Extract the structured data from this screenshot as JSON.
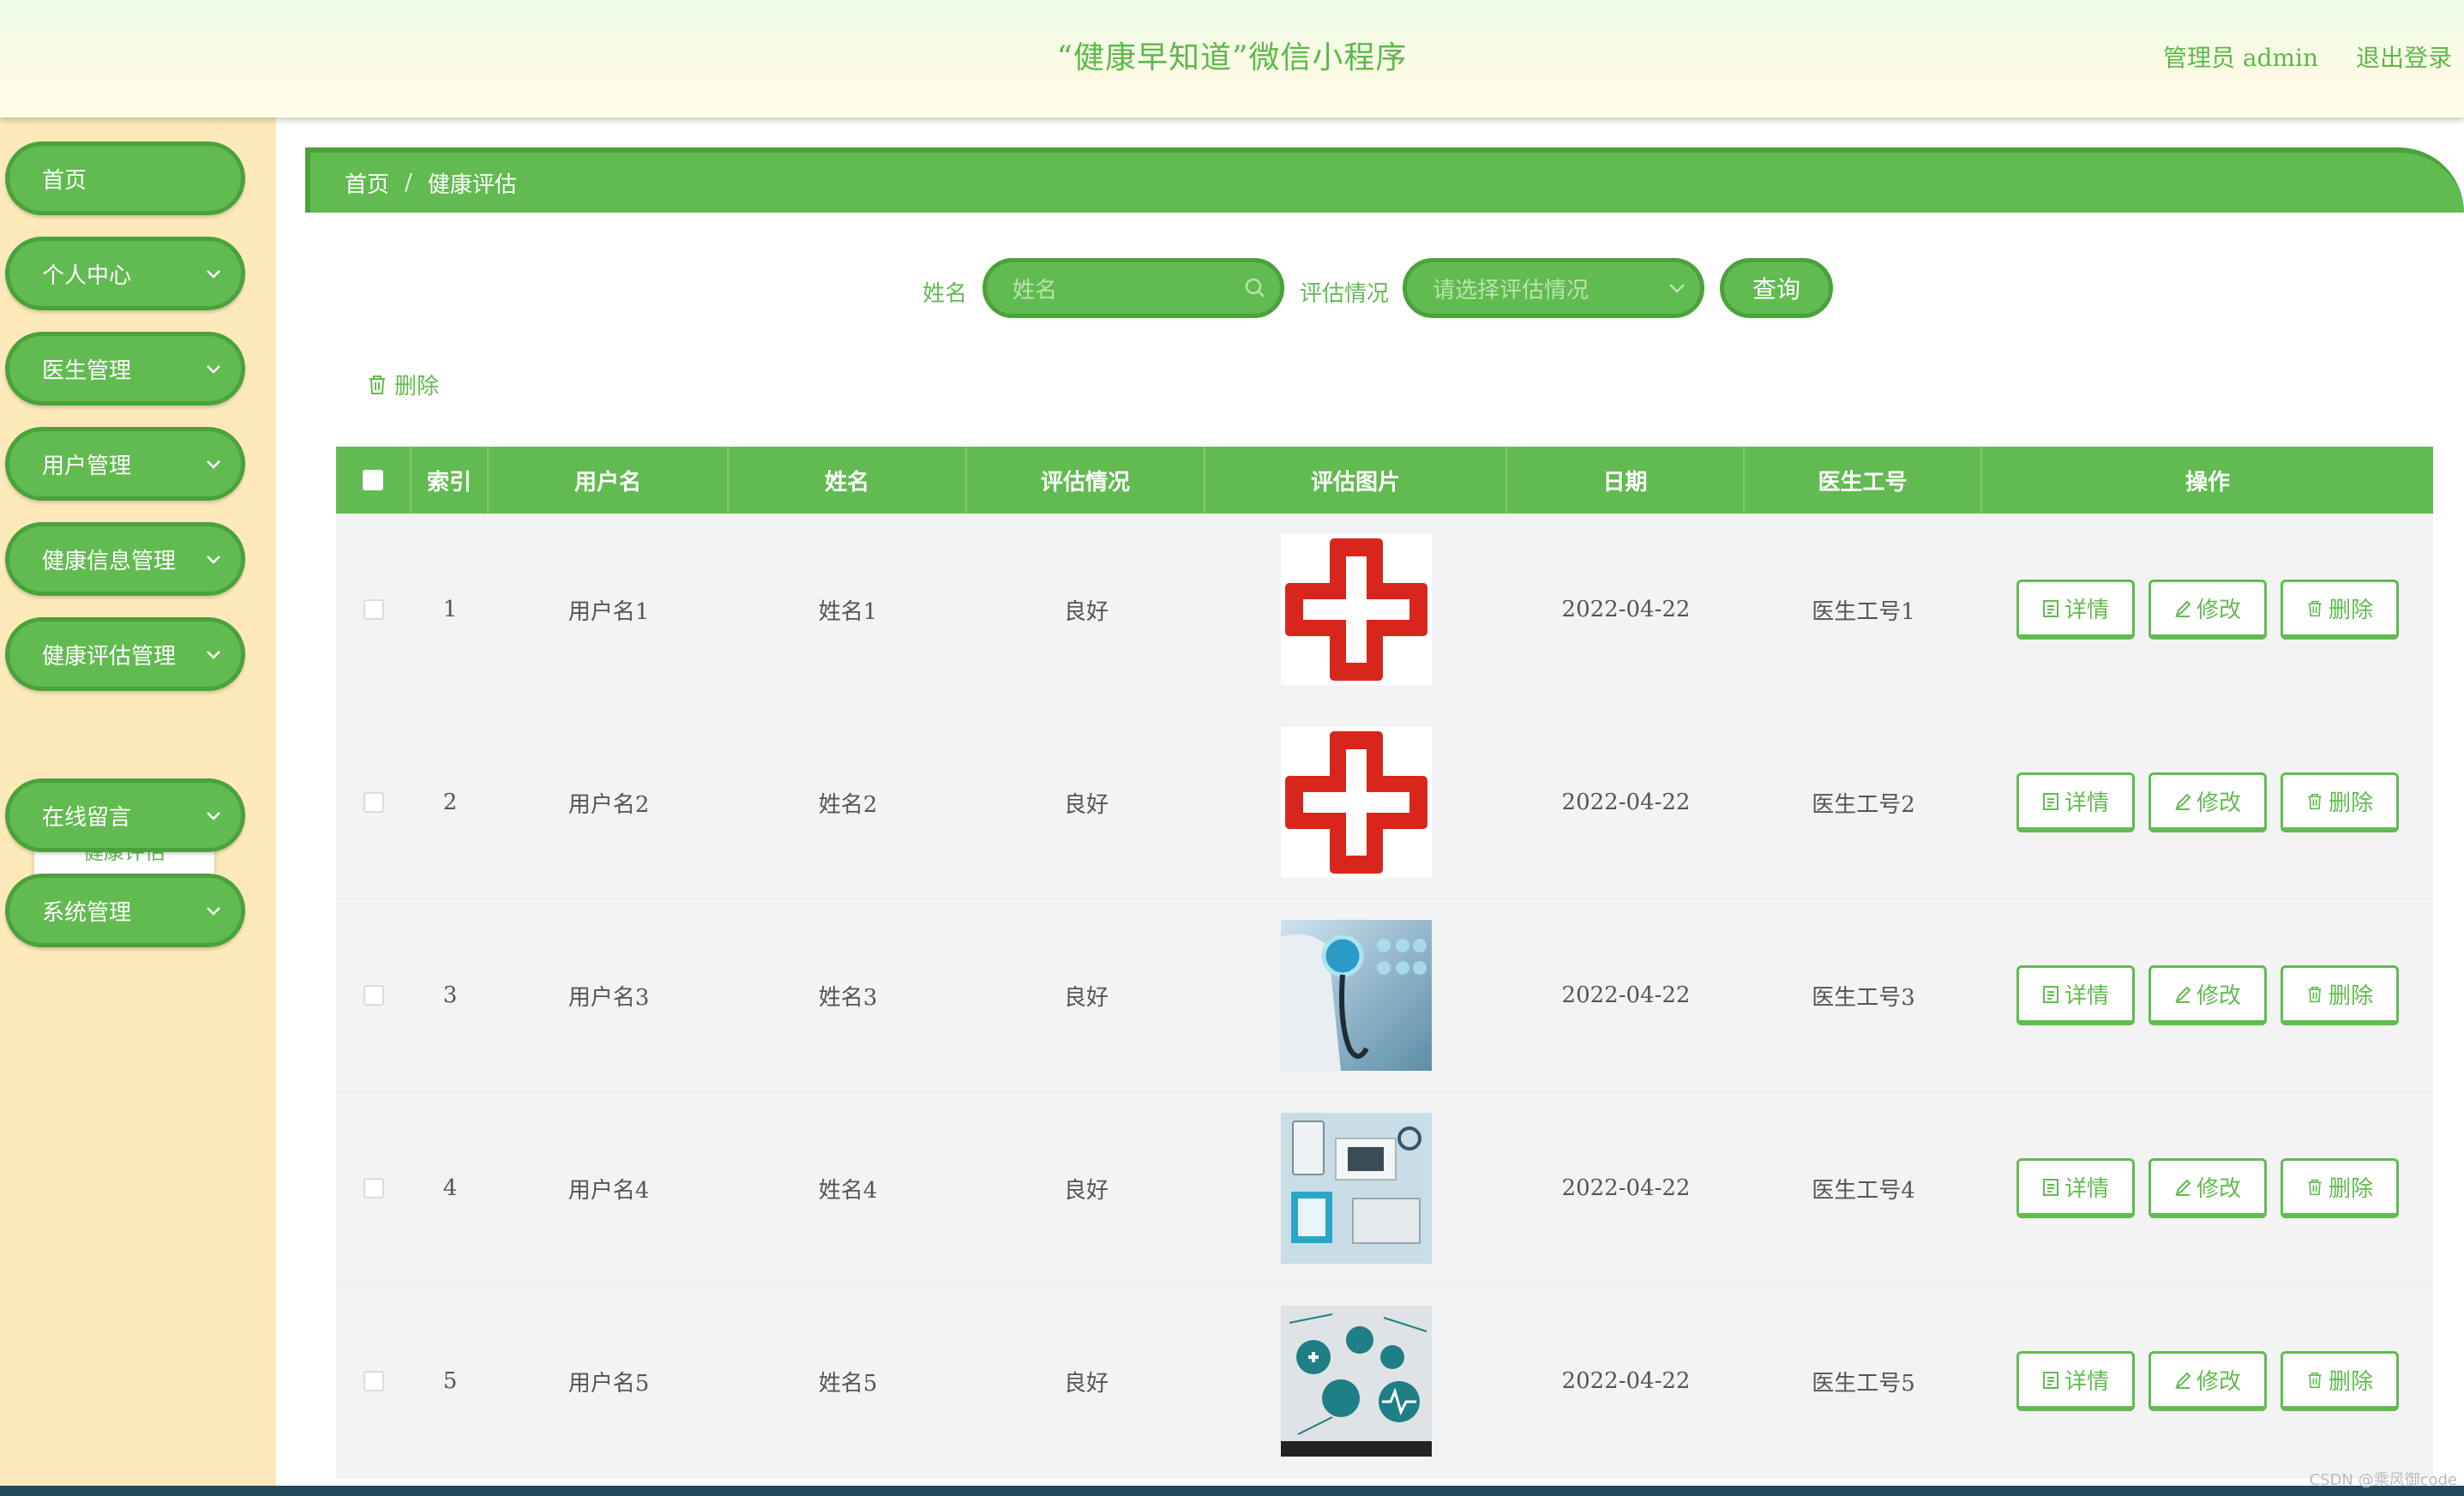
{
  "header": {
    "title": "“健康早知道”微信小程序",
    "admin_label": "管理员 admin",
    "logout_label": "退出登录"
  },
  "sidebar": {
    "items": [
      {
        "label": "首页",
        "has_arrow": false
      },
      {
        "label": "个人中心",
        "has_arrow": true
      },
      {
        "label": "医生管理",
        "has_arrow": true
      },
      {
        "label": "用户管理",
        "has_arrow": true
      },
      {
        "label": "健康信息管理",
        "has_arrow": true
      },
      {
        "label": "健康评估管理",
        "has_arrow": true
      },
      {
        "label": "在线留言",
        "has_arrow": true
      },
      {
        "label": "系统管理",
        "has_arrow": true
      }
    ],
    "submenu_label": "健康评估"
  },
  "breadcrumb": {
    "home": "首页",
    "sep": "/",
    "current": "健康评估"
  },
  "search": {
    "name_label": "姓名",
    "name_placeholder": "姓名",
    "status_label": "评估情况",
    "status_placeholder": "请选择评估情况",
    "query_label": "查询"
  },
  "toolbar": {
    "delete_label": "删除"
  },
  "table": {
    "headers": [
      "索引",
      "用户名",
      "姓名",
      "评估情况",
      "评估图片",
      "日期",
      "医生工号",
      "操作"
    ],
    "rows": [
      {
        "index": "1",
        "username": "用户名1",
        "name": "姓名1",
        "status": "良好",
        "image": "red-cross-icon",
        "date": "2022-04-22",
        "doctor_id": "医生工号1"
      },
      {
        "index": "2",
        "username": "用户名2",
        "name": "姓名2",
        "status": "良好",
        "image": "red-cross-icon",
        "date": "2022-04-22",
        "doctor_id": "医生工号2"
      },
      {
        "index": "3",
        "username": "用户名3",
        "name": "姓名3",
        "status": "良好",
        "image": "stethoscope-photo",
        "date": "2022-04-22",
        "doctor_id": "医生工号3"
      },
      {
        "index": "4",
        "username": "用户名4",
        "name": "姓名4",
        "status": "良好",
        "image": "doctor-desk-photo",
        "date": "2022-04-22",
        "doctor_id": "医生工号4"
      },
      {
        "index": "5",
        "username": "用户名5",
        "name": "姓名5",
        "status": "良好",
        "image": "medical-icons-photo",
        "date": "2022-04-22",
        "doctor_id": "医生工号5"
      }
    ],
    "actions": {
      "detail": "详情",
      "edit": "修改",
      "delete": "删除"
    }
  },
  "watermark": "CSDN @乘风御code",
  "colors": {
    "accent": "#62bb51",
    "accent_dark": "#4aa23b",
    "sidebar_bg": "#fde9b9",
    "cross_red": "#d9261c"
  }
}
